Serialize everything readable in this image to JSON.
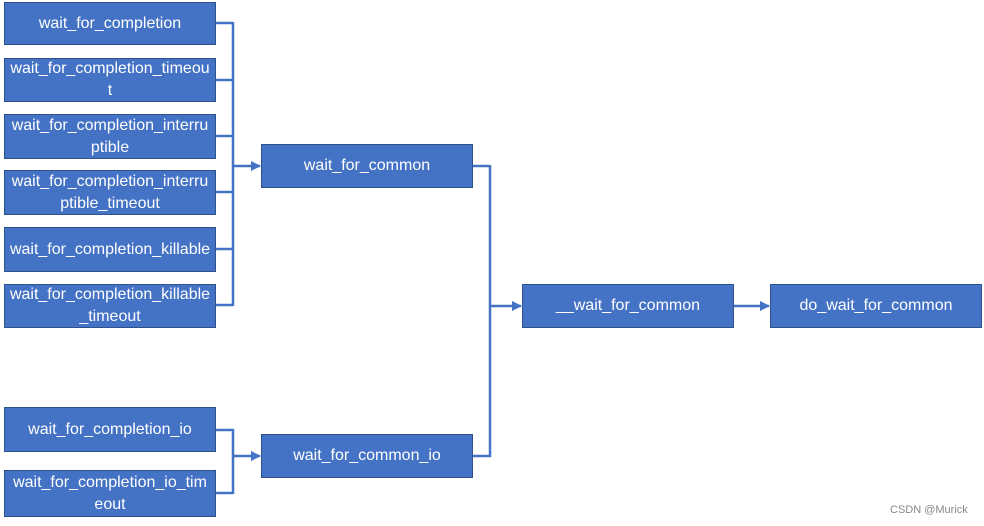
{
  "colors": {
    "box": "#4472C4",
    "line": "#4472C4",
    "text": "#FFFFFF"
  },
  "left_nodes": [
    "wait_for_completion",
    "wait_for_completion_timeout",
    "wait_for_completion_interruptible",
    "wait_for_completion_interruptible_timeout",
    "wait_for_completion_killable",
    "wait_for_completion_killable_timeout",
    "wait_for_completion_io",
    "wait_for_completion_io_timeout"
  ],
  "middle_nodes": [
    "wait_for_common",
    "wait_for_common_io"
  ],
  "core_node": "__wait_for_common",
  "final_node": "do_wait_for_common",
  "watermark": "CSDN @Murick"
}
